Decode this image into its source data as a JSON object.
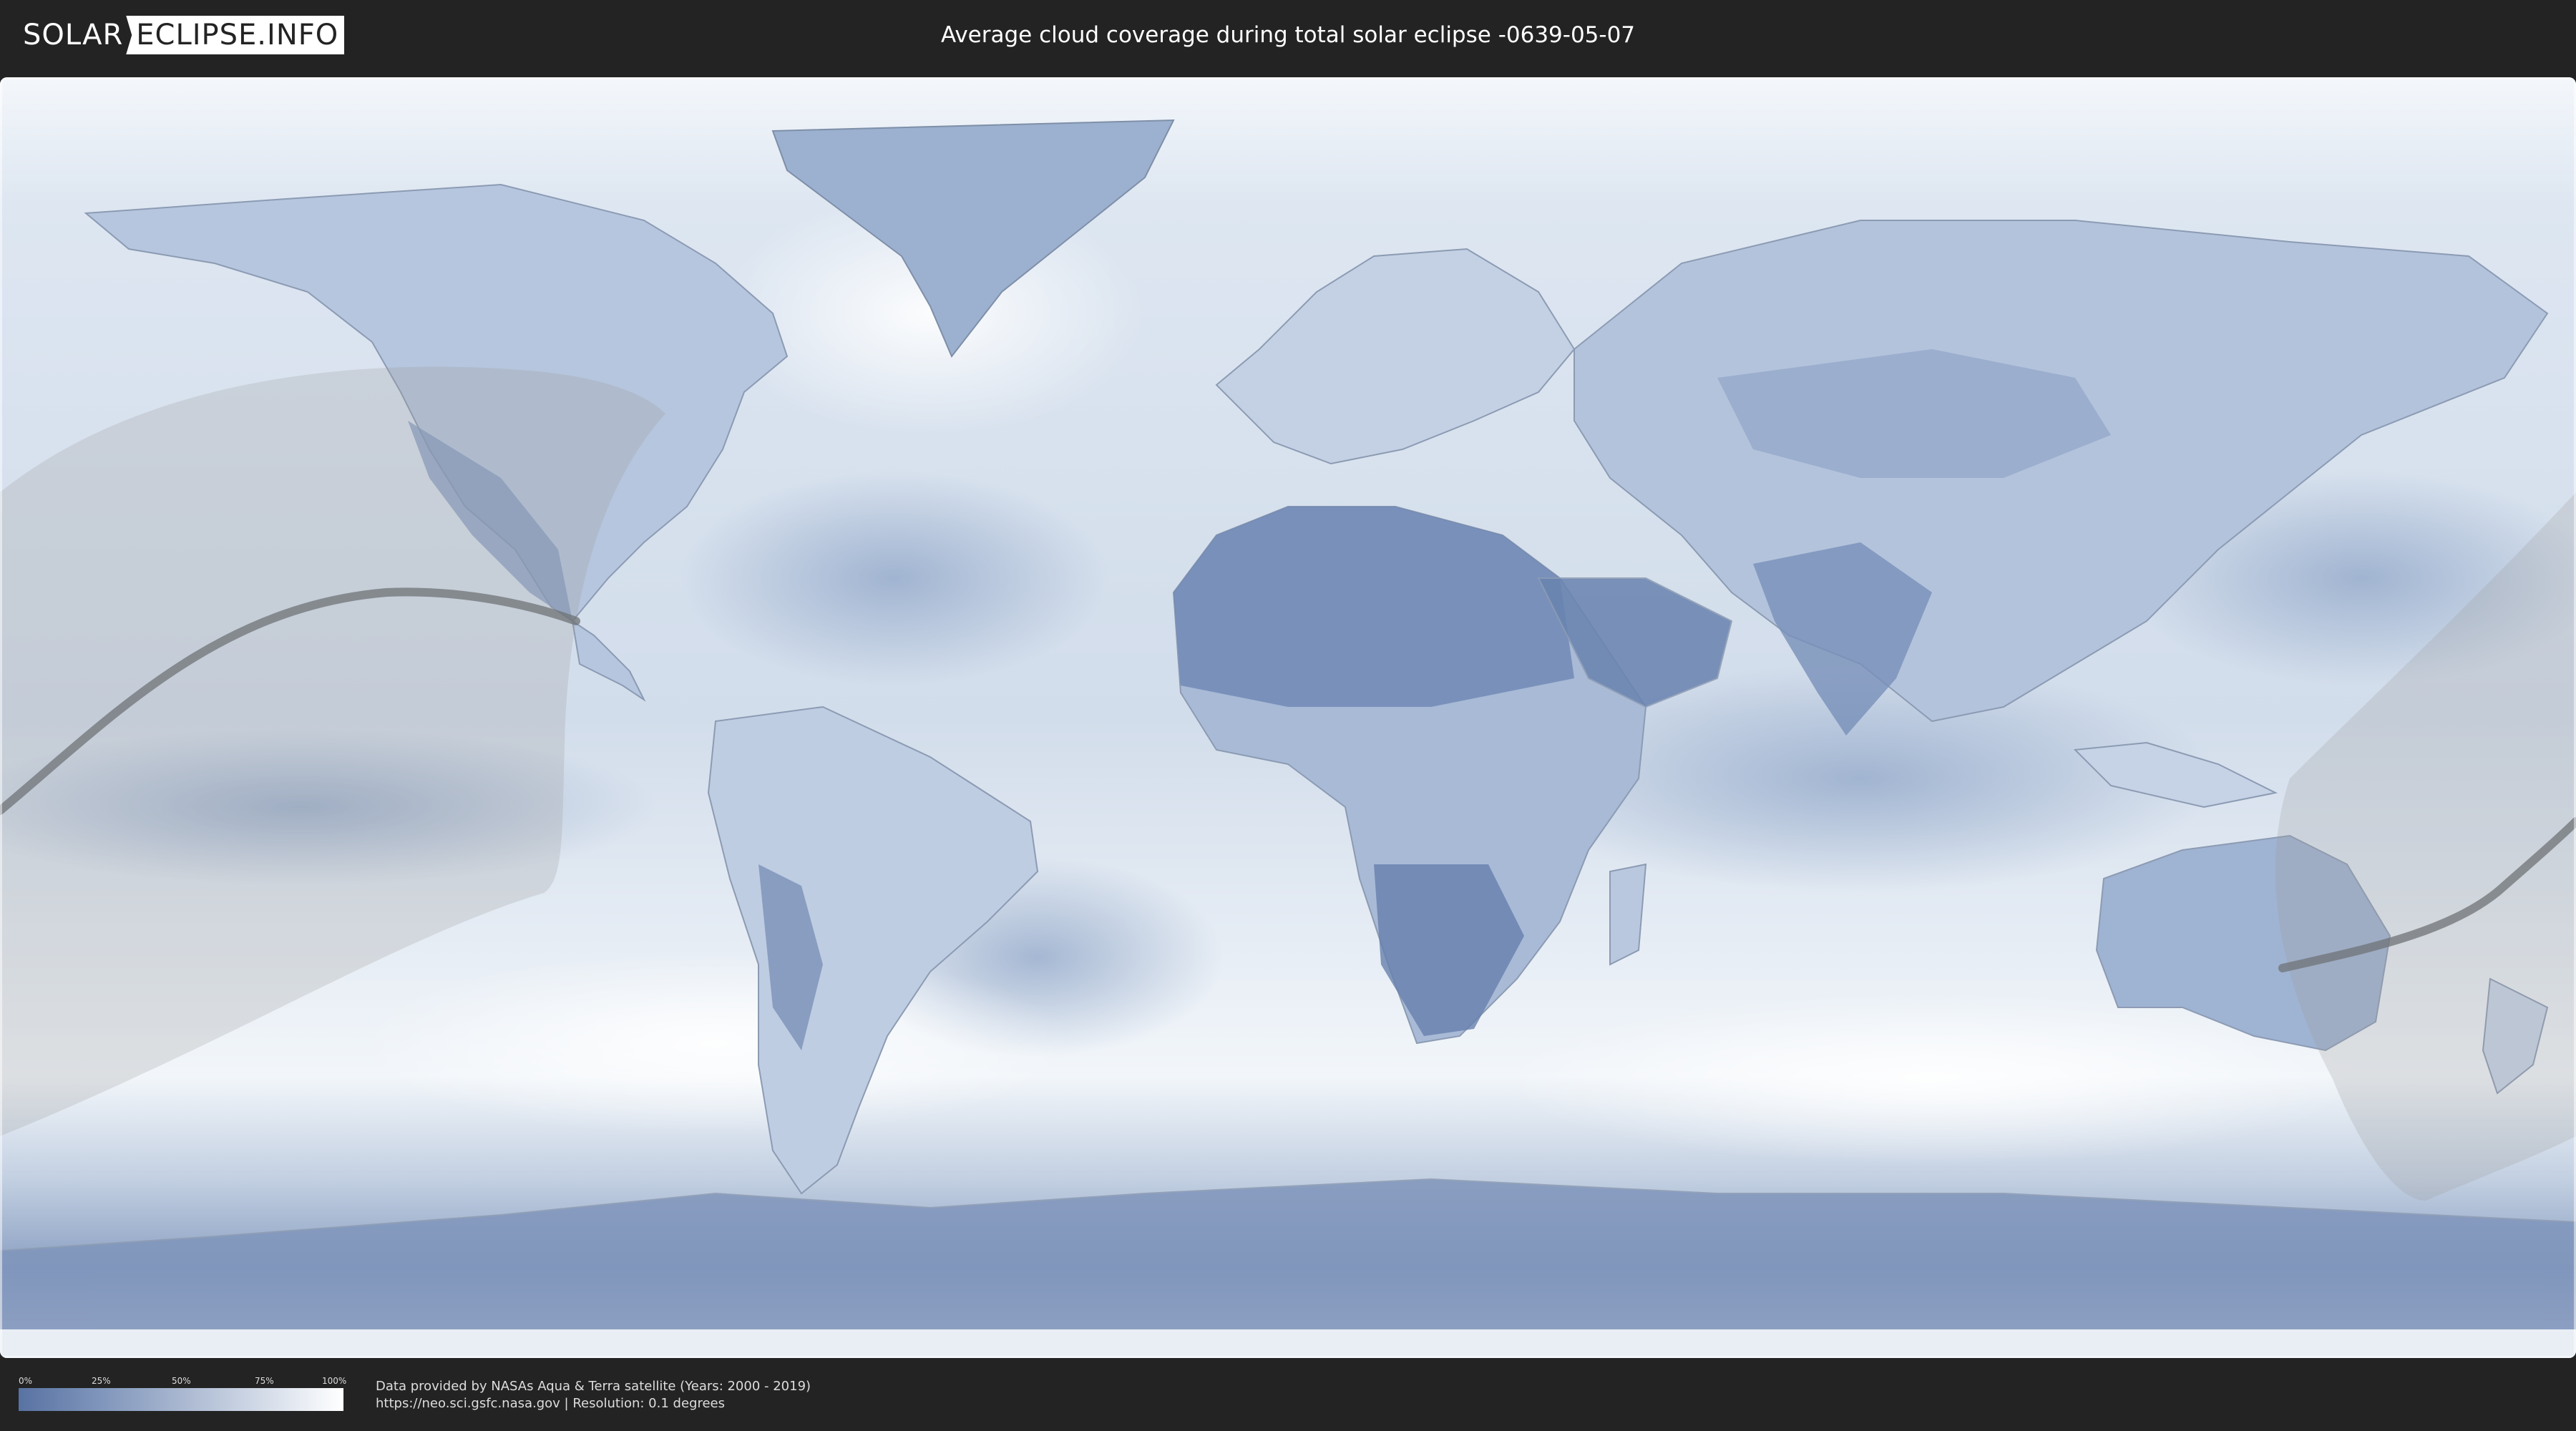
{
  "header": {
    "logo_left": "SOLAR",
    "logo_right": "ECLIPSE.INFO",
    "title": "Average cloud coverage during total solar eclipse -0639-05-07"
  },
  "legend": {
    "scale_labels": [
      "0%",
      "25%",
      "50%",
      "75%",
      "100%"
    ],
    "scale_colors": [
      "#5872a2",
      "#7f95bb",
      "#a9b7d0",
      "#d3dbe8",
      "#ffffff"
    ]
  },
  "footer": {
    "credit_line_1": "Data provided by NASAs Aqua & Terra satellite (Years: 2000 - 2019)",
    "credit_line_2": "https://neo.sci.gsfc.nasa.gov | Resolution: 0.1 degrees"
  },
  "colors": {
    "background": "#232323",
    "map_base": "#e8eef6",
    "low_cloud": "#5872a2",
    "high_cloud": "#ffffff",
    "eclipse_overlay": "#9a9a9a",
    "central_line": "#6f7377"
  }
}
